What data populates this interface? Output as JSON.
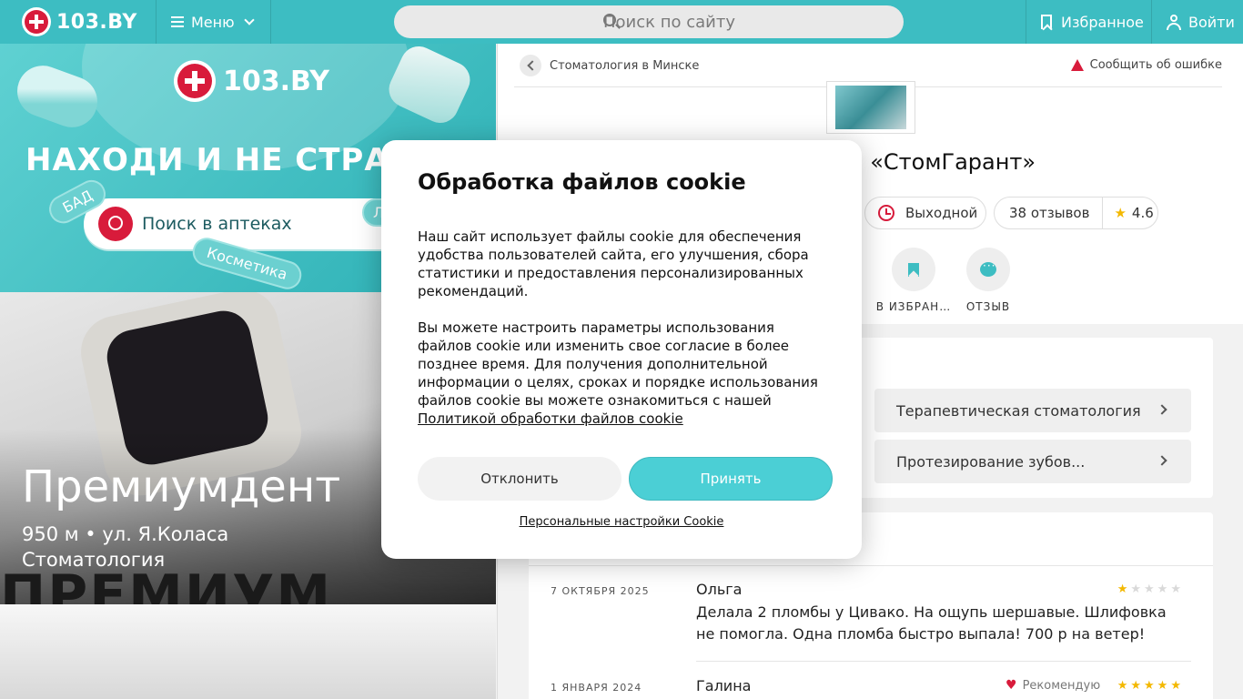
{
  "header": {
    "logo_text": "103.BY",
    "menu_label": "Меню",
    "search_placeholder": "Поиск по сайту",
    "favorites_label": "Избранное",
    "login_label": "Войти"
  },
  "ad_banner": {
    "logo_text": "103.BY",
    "slogan": "НАХОДИ И НЕ СТРА",
    "search_label": "Поиск в аптеках",
    "tags": [
      "БАД",
      "Косметика",
      "Л"
    ]
  },
  "promo": {
    "title": "Премиумдент",
    "subtitle_line1": "950 м • ул. Я.Коласа",
    "subtitle_line2": "Стоматология",
    "background_text": "ПРЕМИУМ"
  },
  "clinic": {
    "breadcrumb": "Стоматология в Минске",
    "report_error": "Сообщить об ошибке",
    "title": "и «СтомГарант»",
    "status": "Выходной",
    "reviews_count": "38 отзывов",
    "rating": "4.6",
    "actions": [
      {
        "label": "В ИЗБРАН…",
        "icon": "bookmark-icon"
      },
      {
        "label": "ОТЗЫВ",
        "icon": "chat-icon"
      }
    ]
  },
  "services": [
    {
      "label": "Терапевтическая стоматология"
    },
    {
      "label": "Протезирование зубов..."
    }
  ],
  "reviews": [
    {
      "date": "7 октября 2025",
      "author": "Ольга",
      "rating": 1,
      "text": "Делала 2 пломбы у Цивако. На ощупь шершавые. Шлифовка не помогла. Одна пломба быстро выпала! 700 р на ветер!"
    },
    {
      "date": "1 января 2024",
      "author": "Галина",
      "rating": 5,
      "recommend": "Рекомендую"
    }
  ],
  "cookie_modal": {
    "title": "Обработка файлов cookie",
    "paragraph1": "Наш сайт использует файлы cookie для обеспечения удобства пользователей сайта, его улучшения, сбора статистики и предоставления персонализированных рекомендаций.",
    "paragraph2": "Вы можете настроить параметры использования файлов cookie или изменить свое согласие в более позднее время. Для получения дополнительной информации о целях, сроках и порядке использования файлов cookie вы можете ознакомиться с нашей ",
    "policy_link": "Политикой обработки файлов cookie",
    "decline_label": "Отклонить",
    "accept_label": "Принять",
    "settings_link": "Персональные настройки Cookie"
  },
  "colors": {
    "brand_teal": "#3dbdc2",
    "brand_red": "#d81b3b",
    "star": "#f3b800",
    "accept_button": "#4bcfd5"
  }
}
